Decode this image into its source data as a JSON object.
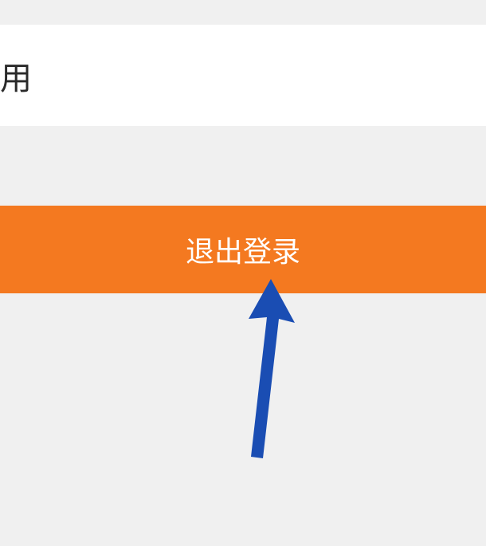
{
  "row": {
    "text": "用"
  },
  "logout": {
    "label": "退出登录"
  }
}
